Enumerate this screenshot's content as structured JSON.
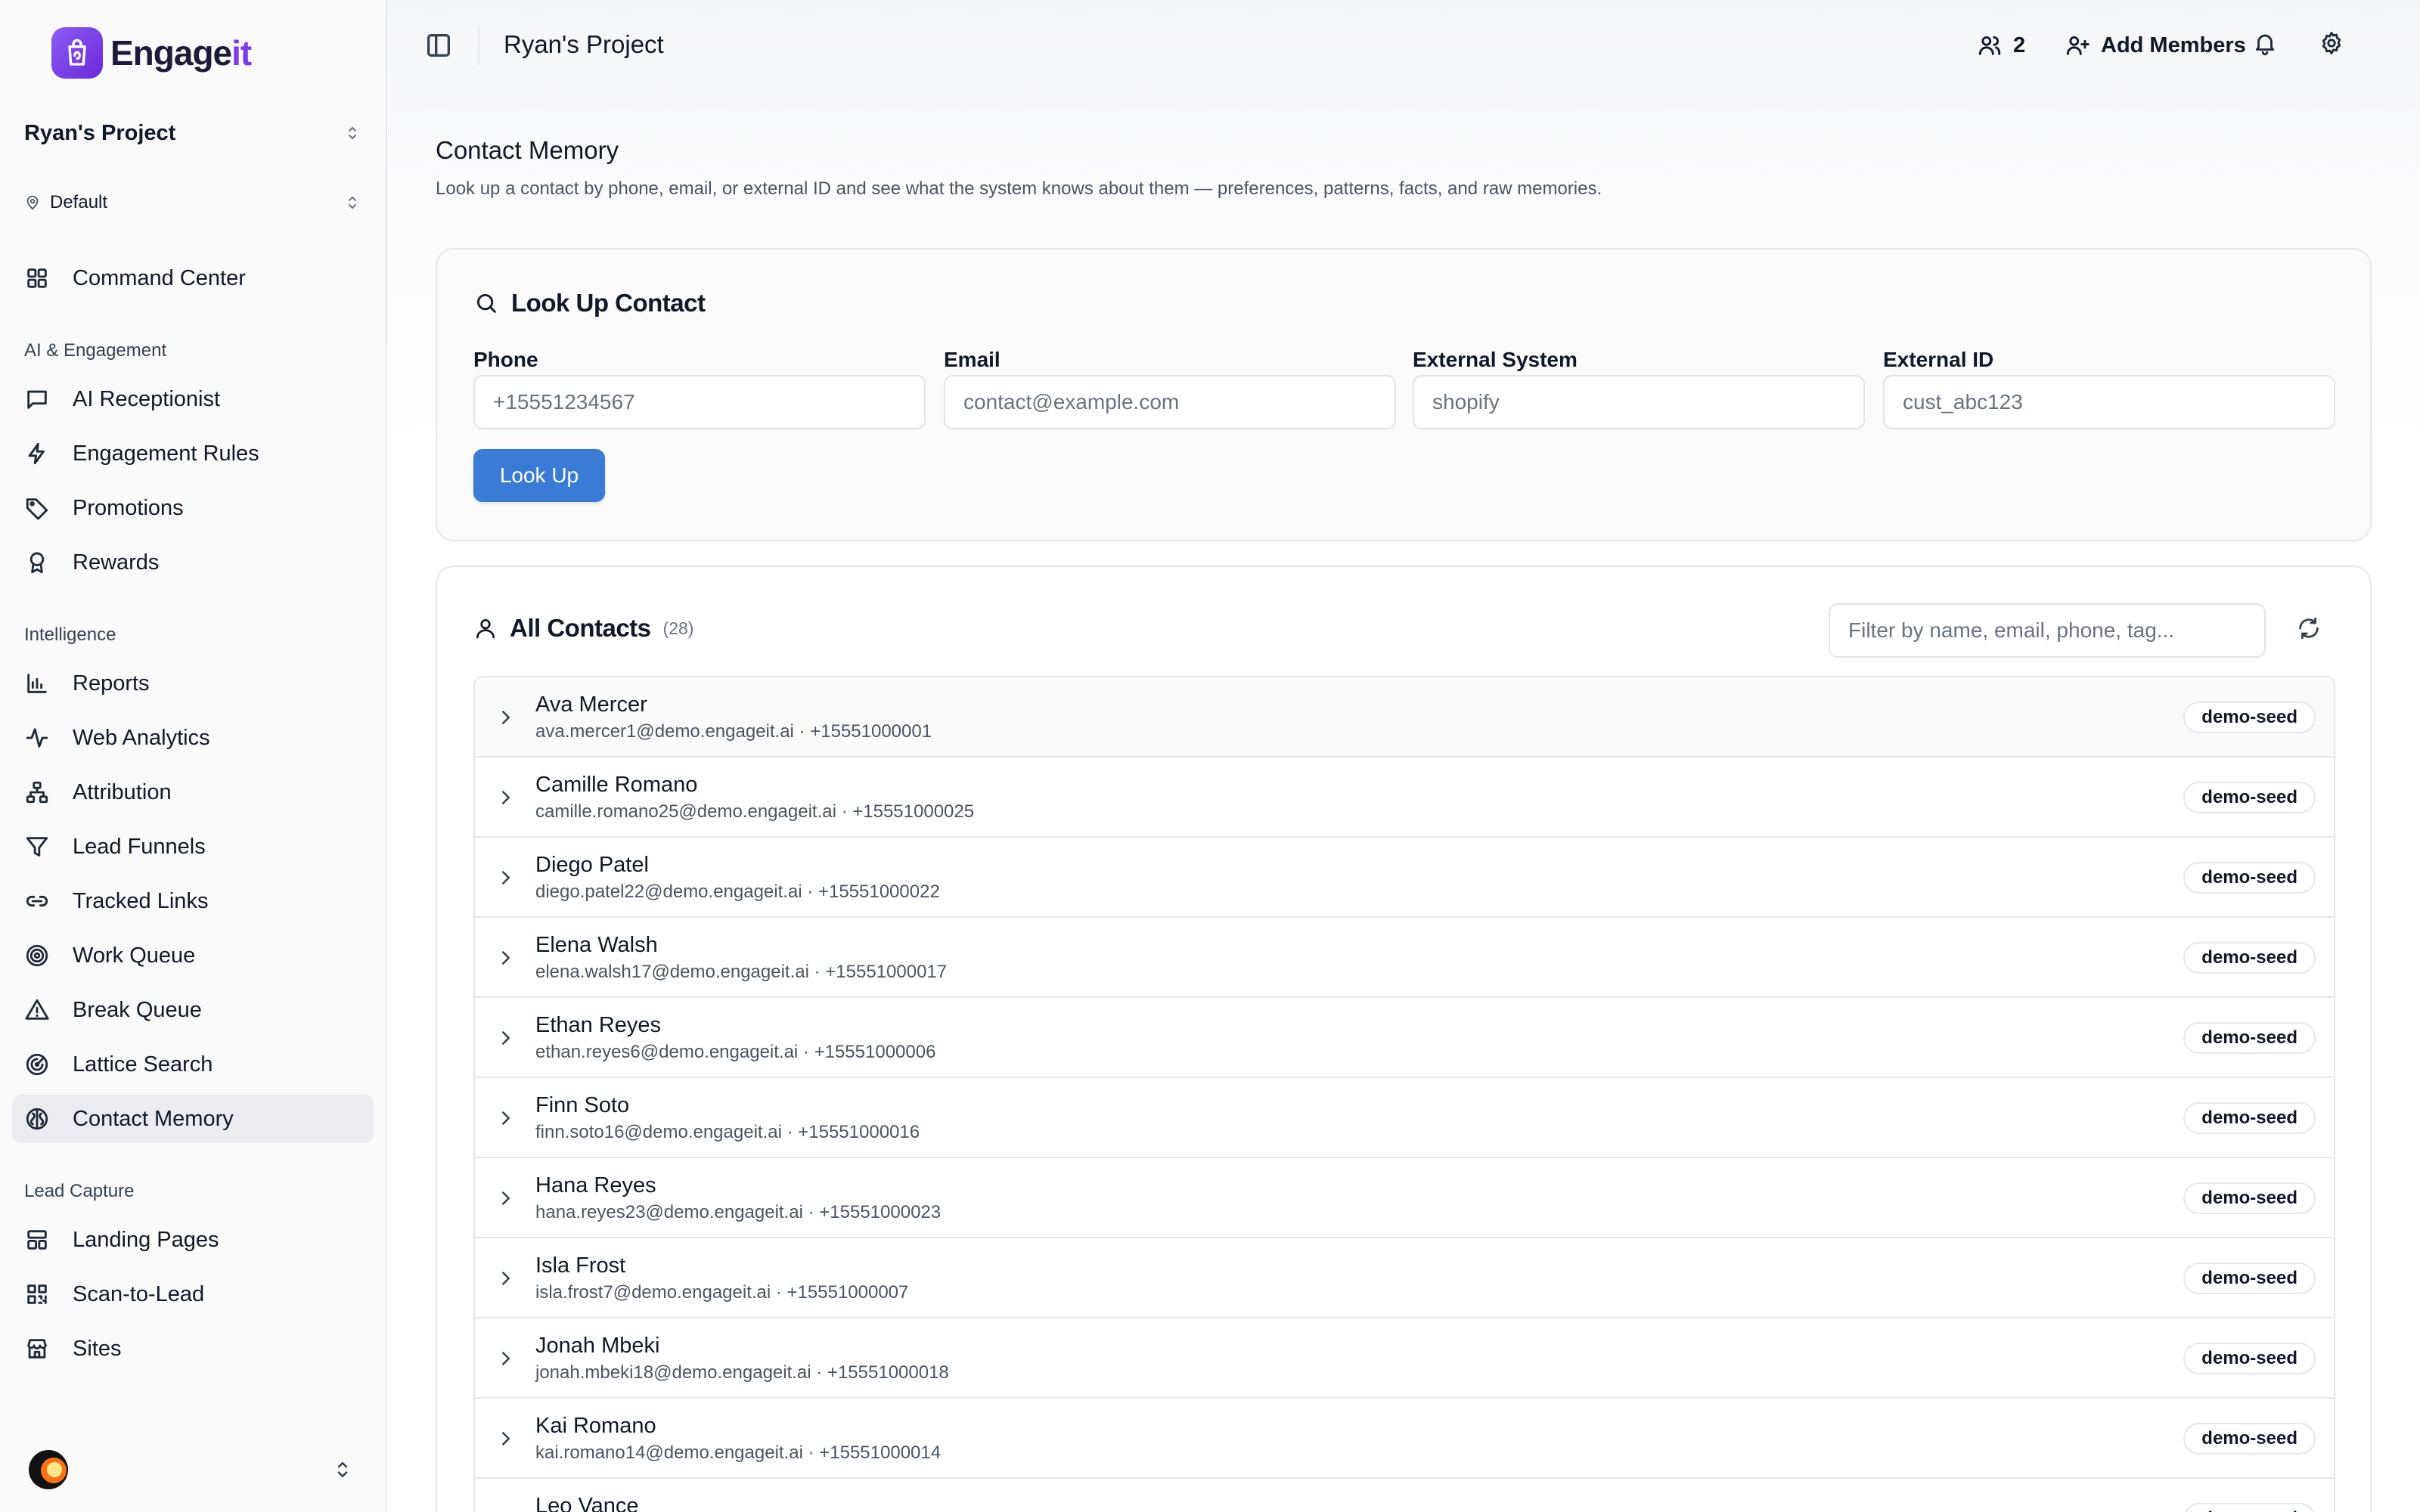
{
  "brand": {
    "name_main": "Engage",
    "name_accent": "it",
    "accent_color": "#7c3aed"
  },
  "project_switcher": {
    "label": "Ryan's Project"
  },
  "environment_switcher": {
    "label": "Default"
  },
  "sidebar": {
    "command_center": "Command Center",
    "sections": {
      "ai": "AI & Engagement",
      "intelligence": "Intelligence",
      "lead_capture": "Lead Capture"
    },
    "items": {
      "ai_receptionist": "AI Receptionist",
      "engagement_rules": "Engagement Rules",
      "promotions": "Promotions",
      "rewards": "Rewards",
      "reports": "Reports",
      "web_analytics": "Web Analytics",
      "attribution": "Attribution",
      "lead_funnels": "Lead Funnels",
      "tracked_links": "Tracked Links",
      "work_queue": "Work Queue",
      "break_queue": "Break Queue",
      "lattice_search": "Lattice Search",
      "contact_memory": "Contact Memory",
      "landing_pages": "Landing Pages",
      "scan_to_lead": "Scan-to-Lead",
      "sites": "Sites"
    },
    "active": "contact_memory"
  },
  "header": {
    "title": "Ryan's Project",
    "members_count": "2",
    "add_members_label": "Add Members"
  },
  "page": {
    "title": "Contact Memory",
    "description": "Look up a contact by phone, email, or external ID and see what the system knows about them — preferences, patterns, facts, and raw memories."
  },
  "lookup": {
    "title": "Look Up Contact",
    "fields": {
      "phone": {
        "label": "Phone",
        "placeholder": "+15551234567",
        "value": ""
      },
      "email": {
        "label": "Email",
        "placeholder": "contact@example.com",
        "value": ""
      },
      "external_system": {
        "label": "External System",
        "placeholder": "shopify",
        "value": ""
      },
      "external_id": {
        "label": "External ID",
        "placeholder": "cust_abc123",
        "value": ""
      }
    },
    "button_label": "Look Up"
  },
  "contacts": {
    "title": "All Contacts",
    "count_text": "(28)",
    "filter_placeholder": "Filter by name, email, phone, tag...",
    "rows": [
      {
        "name": "Ava Mercer",
        "meta": "ava.mercer1@demo.engageit.ai · +15551000001",
        "tag": "demo-seed"
      },
      {
        "name": "Camille Romano",
        "meta": "camille.romano25@demo.engageit.ai · +15551000025",
        "tag": "demo-seed"
      },
      {
        "name": "Diego Patel",
        "meta": "diego.patel22@demo.engageit.ai · +15551000022",
        "tag": "demo-seed"
      },
      {
        "name": "Elena Walsh",
        "meta": "elena.walsh17@demo.engageit.ai · +15551000017",
        "tag": "demo-seed"
      },
      {
        "name": "Ethan Reyes",
        "meta": "ethan.reyes6@demo.engageit.ai · +15551000006",
        "tag": "demo-seed"
      },
      {
        "name": "Finn Soto",
        "meta": "finn.soto16@demo.engageit.ai · +15551000016",
        "tag": "demo-seed"
      },
      {
        "name": "Hana Reyes",
        "meta": "hana.reyes23@demo.engageit.ai · +15551000023",
        "tag": "demo-seed"
      },
      {
        "name": "Isla Frost",
        "meta": "isla.frost7@demo.engageit.ai · +15551000007",
        "tag": "demo-seed"
      },
      {
        "name": "Jonah Mbeki",
        "meta": "jonah.mbeki18@demo.engageit.ai · +15551000018",
        "tag": "demo-seed"
      },
      {
        "name": "Kai Romano",
        "meta": "kai.romano14@demo.engageit.ai · +15551000014",
        "tag": "demo-seed"
      },
      {
        "name": "Leo Vance",
        "meta": "",
        "tag": "demo-seed"
      }
    ]
  },
  "colors": {
    "primary_button": "#3a7bd5",
    "chat_fab": "#2563eb",
    "active_nav_bg": "#ececf0"
  }
}
